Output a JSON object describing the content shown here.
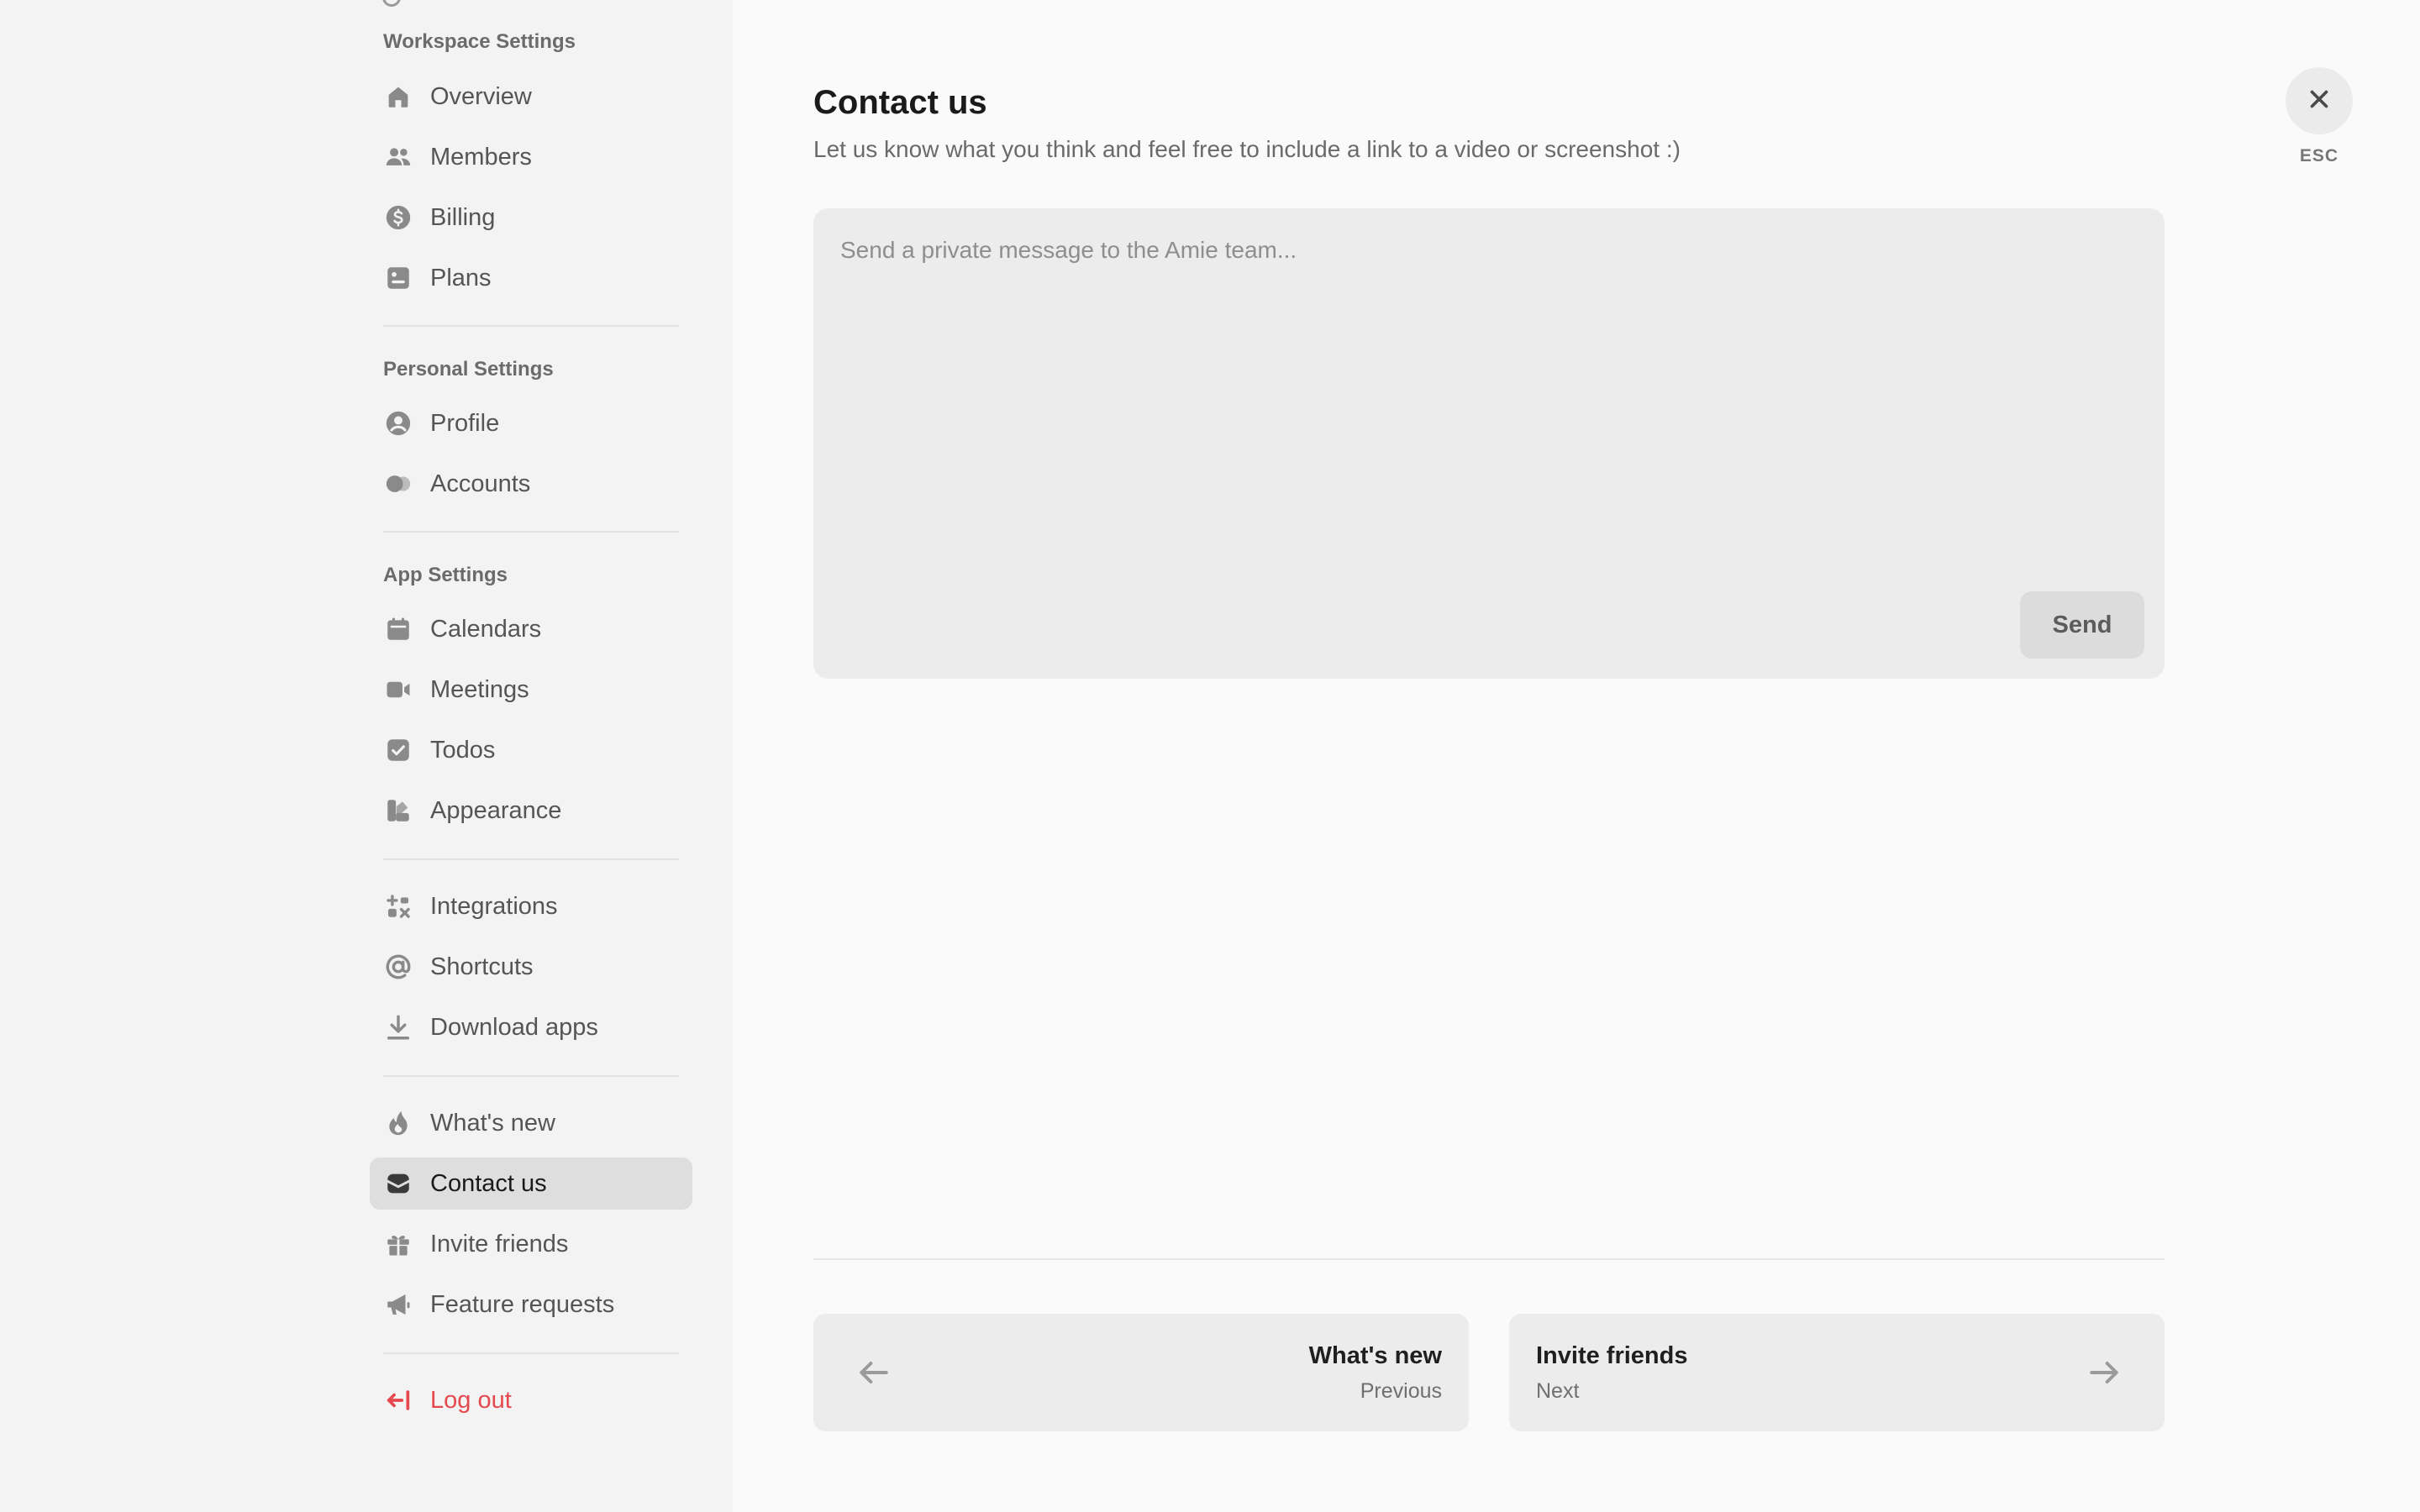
{
  "sidebar": {
    "sections": {
      "workspace": "Workspace Settings",
      "personal": "Personal Settings",
      "app": "App Settings"
    },
    "items": [
      {
        "label": "Overview",
        "icon": "home-icon"
      },
      {
        "label": "Members",
        "icon": "users-icon"
      },
      {
        "label": "Billing",
        "icon": "dollar-icon"
      },
      {
        "label": "Plans",
        "icon": "plans-icon"
      },
      {
        "label": "Profile",
        "icon": "user-circle-icon"
      },
      {
        "label": "Accounts",
        "icon": "accounts-icon"
      },
      {
        "label": "Calendars",
        "icon": "calendar-icon"
      },
      {
        "label": "Meetings",
        "icon": "video-icon"
      },
      {
        "label": "Todos",
        "icon": "check-icon"
      },
      {
        "label": "Appearance",
        "icon": "palette-icon"
      },
      {
        "label": "Integrations",
        "icon": "integrations-icon"
      },
      {
        "label": "Shortcuts",
        "icon": "at-icon"
      },
      {
        "label": "Download apps",
        "icon": "download-icon"
      },
      {
        "label": "What's new",
        "icon": "flame-icon"
      },
      {
        "label": "Contact us",
        "icon": "mail-icon",
        "active": true
      },
      {
        "label": "Invite friends",
        "icon": "gift-icon"
      },
      {
        "label": "Feature requests",
        "icon": "megaphone-icon"
      }
    ],
    "logout": {
      "label": "Log out",
      "icon": "logout-icon"
    }
  },
  "main": {
    "title": "Contact us",
    "subtitle": "Let us know what you think and feel free to include a link to a video or screenshot :)",
    "message": {
      "placeholder": "Send a private message to the Amie team...",
      "value": ""
    },
    "send_label": "Send",
    "close": {
      "icon": "close-icon",
      "hint": "ESC"
    },
    "pager": {
      "prev": {
        "title": "What's new",
        "subtitle": "Previous"
      },
      "next": {
        "title": "Invite friends",
        "subtitle": "Next"
      }
    }
  },
  "colors": {
    "sidebar_bg": "#f3f3f3",
    "main_bg": "#fafafa",
    "active_item_bg": "#dedede",
    "danger": "#e5484d",
    "icon_gray": "#8a8a8a"
  }
}
